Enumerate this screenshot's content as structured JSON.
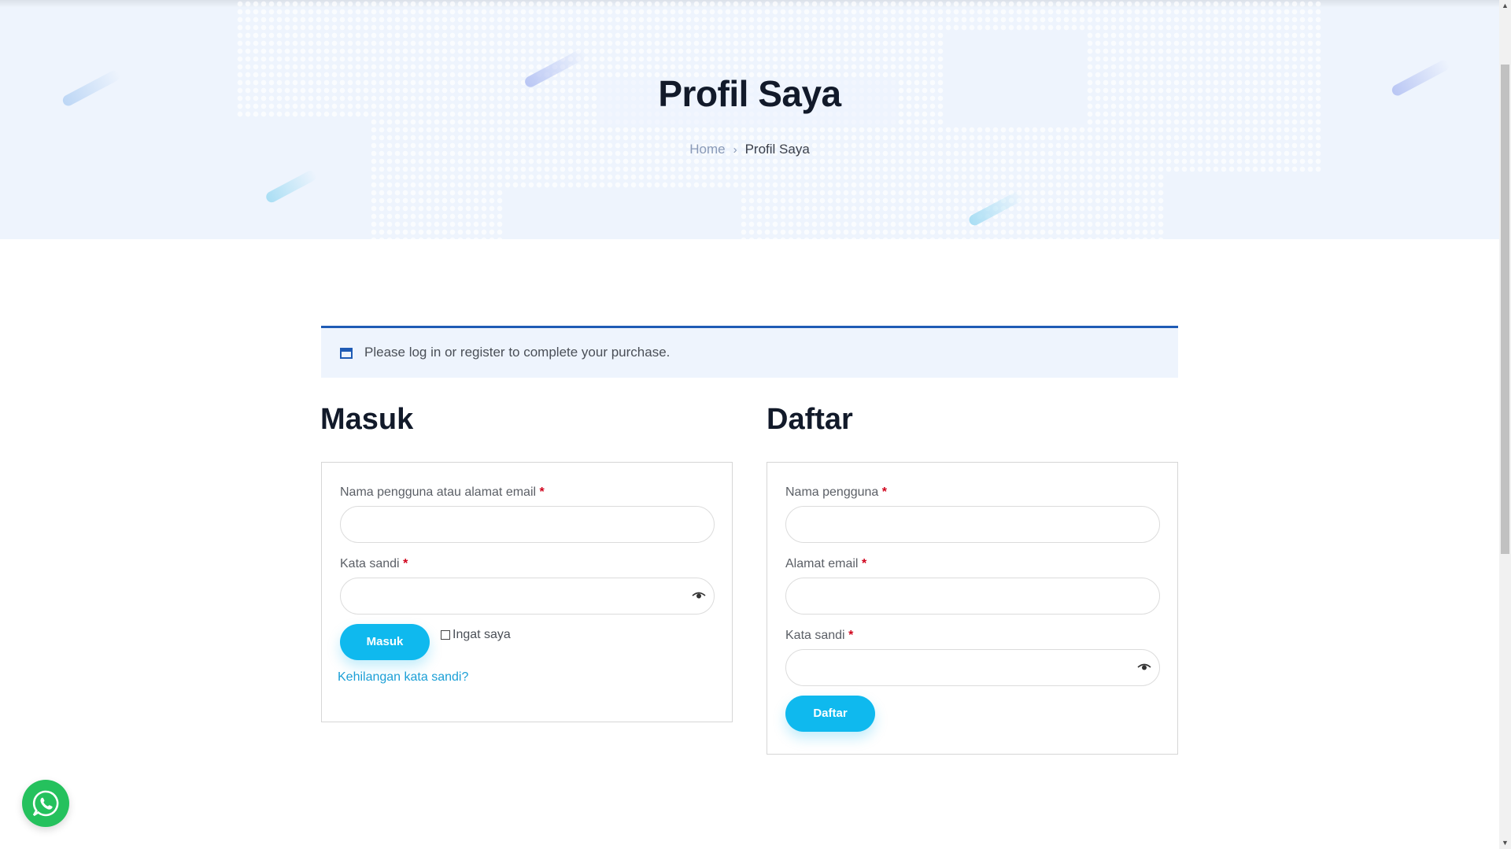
{
  "hero": {
    "title": "Profil Saya",
    "breadcrumb": {
      "home": "Home",
      "separator": "›",
      "current": "Profil Saya"
    }
  },
  "notice": {
    "icon": "window-icon",
    "text": "Please log in or register to complete your purchase."
  },
  "login": {
    "title": "Masuk",
    "username_label": "Nama pengguna atau alamat email",
    "username_value": "",
    "password_label": "Kata sandi",
    "password_value": "",
    "required_mark": "*",
    "submit_label": "Masuk",
    "remember_label": "Ingat saya",
    "remember_checked": false,
    "lost_password": "Kehilangan kata sandi?"
  },
  "register": {
    "title": "Daftar",
    "username_label": "Nama pengguna",
    "username_value": "",
    "email_label": "Alamat email",
    "email_value": "",
    "password_label": "Kata sandi",
    "password_value": "",
    "required_mark": "*",
    "submit_label": "Daftar"
  },
  "colors": {
    "accent": "#0fb9ee",
    "notice_border": "#1f5bb5",
    "hero_bg": "#eef4fd",
    "required": "#d0021b",
    "whatsapp": "#25c15d"
  },
  "floating": {
    "icon": "whatsapp-icon"
  }
}
